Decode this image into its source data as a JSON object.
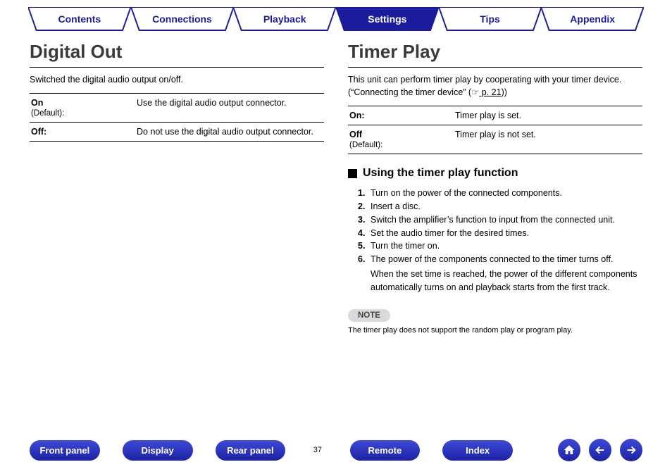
{
  "tabs": [
    {
      "label": "Contents",
      "active": false
    },
    {
      "label": "Connections",
      "active": false
    },
    {
      "label": "Playback",
      "active": false
    },
    {
      "label": "Settings",
      "active": true
    },
    {
      "label": "Tips",
      "active": false
    },
    {
      "label": "Appendix",
      "active": false
    }
  ],
  "left": {
    "heading": "Digital Out",
    "intro": "Switched the digital audio output on/off.",
    "rows": [
      {
        "key": "On",
        "def": "(Default):",
        "desc": "Use the digital audio output connector."
      },
      {
        "key": "Off:",
        "def": "",
        "desc": "Do not use the digital audio output connector."
      }
    ]
  },
  "right": {
    "heading": "Timer Play",
    "intro1": "This unit can perform timer play by cooperating with your timer device.",
    "intro2a": "(“Connecting the timer device” (",
    "intro2b": " p. 21",
    "intro2c": "))",
    "rows": [
      {
        "key": "On:",
        "def": "",
        "desc": "Timer play is set."
      },
      {
        "key": "Off",
        "def": "(Default):",
        "desc": "Timer play is not set."
      }
    ],
    "subhead": "Using the timer play function",
    "steps": [
      "Turn on the power of the connected components.",
      "Insert a disc.",
      "Switch the amplifier’s function to input from the connected unit.",
      "Set the audio timer for the desired times.",
      "Turn the timer on.",
      "The power of the components connected to the timer turns off."
    ],
    "extra": "When the set time is reached, the power of the different components automatically turns on and playback starts from the first track.",
    "note_label": "NOTE",
    "note_text": "The timer play does not support the random play or program play."
  },
  "bottom": {
    "buttons_left": [
      "Front panel",
      "Display",
      "Rear panel"
    ],
    "page": "37",
    "buttons_right": [
      "Remote",
      "Index"
    ]
  }
}
